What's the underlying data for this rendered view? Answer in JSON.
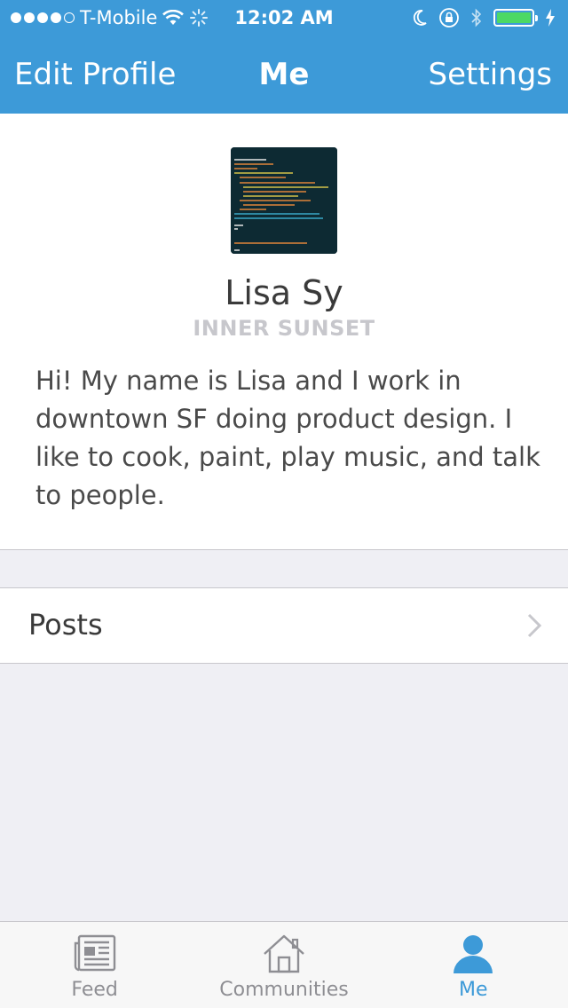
{
  "status_bar": {
    "carrier": "T-Mobile",
    "time": "12:02 AM",
    "signal_dots": 5,
    "signal_filled": 4,
    "battery_color": "#4cd964"
  },
  "nav": {
    "left_button": "Edit Profile",
    "title": "Me",
    "right_button": "Settings"
  },
  "profile": {
    "name": "Lisa Sy",
    "location": "INNER SUNSET",
    "bio": "Hi! My name is Lisa and I work in downtown SF doing product design. I like to cook, paint, play music, and talk to people."
  },
  "posts_row": {
    "label": "Posts"
  },
  "tabs": [
    {
      "label": "Feed",
      "icon": "newspaper-icon",
      "active": false
    },
    {
      "label": "Communities",
      "icon": "house-icon",
      "active": false
    },
    {
      "label": "Me",
      "icon": "person-icon",
      "active": true
    }
  ],
  "colors": {
    "accent": "#3d9ad8",
    "background": "#efeff4"
  }
}
